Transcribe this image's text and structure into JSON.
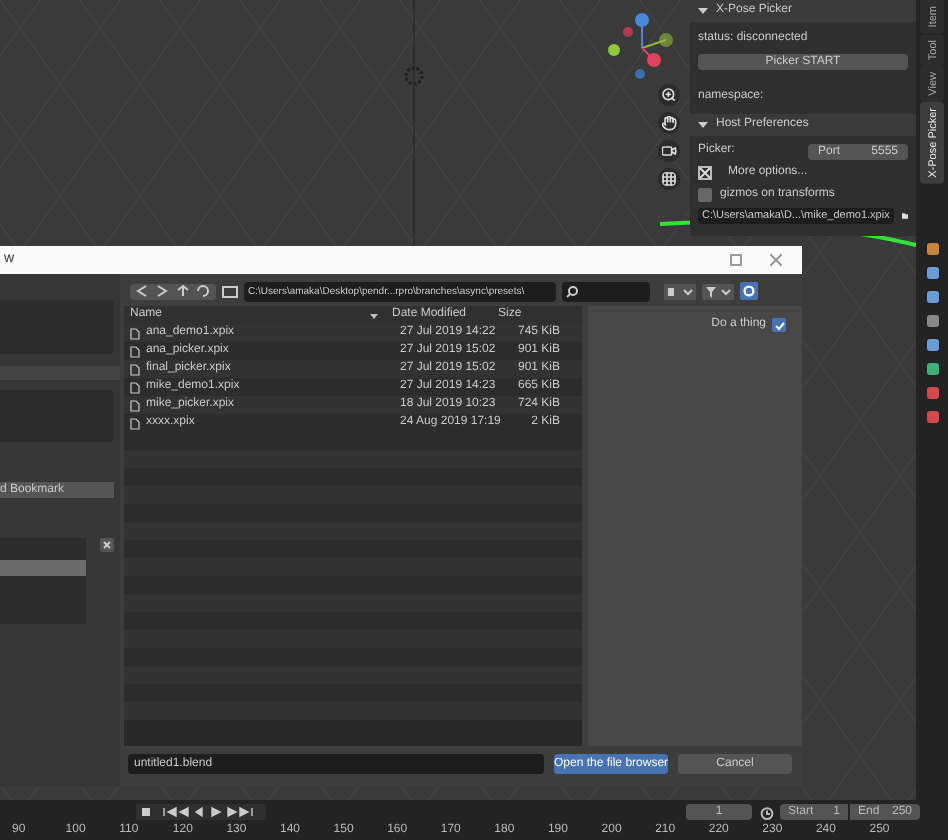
{
  "sidebar": {
    "sections": [
      {
        "title": "X-Pose Picker",
        "expanded": true
      },
      {
        "title": "Host Preferences",
        "expanded": true
      }
    ],
    "status": "status: disconnected",
    "start_button": "Picker START",
    "namespace_label": "namespace:",
    "picker_label": "Picker:",
    "port_label": "Port",
    "port_value": "5555",
    "options": [
      {
        "kind": "toggle",
        "label": "More options...",
        "checked": true
      },
      {
        "kind": "checkbox",
        "label": "gizmos on transforms",
        "checked": false
      }
    ],
    "path_value": "C:\\Users\\amaka\\D...\\mike_demo1.xpix"
  },
  "vertical_tabs": [
    {
      "label": "Item",
      "selected": false
    },
    {
      "label": "Tool",
      "selected": false
    },
    {
      "label": "View",
      "selected": false
    },
    {
      "label": "X-Pose Picker",
      "selected": true
    }
  ],
  "dialog": {
    "title": "w",
    "path": "C:\\Users\\amaka\\Desktop\\pendr...rpro\\branches\\async\\presets\\",
    "bookmark_button": "d Bookmark",
    "columns": [
      "Name",
      "Date Modified",
      "Size"
    ],
    "files": [
      {
        "name": "ana_demo1.xpix",
        "date": "27 Jul 2019 14:22",
        "size": "745 KiB"
      },
      {
        "name": "ana_picker.xpix",
        "date": "27 Jul 2019 15:02",
        "size": "901 KiB"
      },
      {
        "name": "final_picker.xpix",
        "date": "27 Jul 2019 15:02",
        "size": "901 KiB"
      },
      {
        "name": "mike_demo1.xpix",
        "date": "27 Jul 2019 14:23",
        "size": "665 KiB"
      },
      {
        "name": "mike_picker.xpix",
        "date": "18 Jul 2019 10:23",
        "size": "724 KiB"
      },
      {
        "name": "xxxx.xpix",
        "date": "24 Aug 2019 17:19",
        "size": "2 KiB"
      }
    ],
    "option": {
      "label": "Do a thing",
      "checked": true
    },
    "filename": "untitled1.blend",
    "buttons": [
      {
        "label": "Open the file browser",
        "kind": "primary"
      },
      {
        "label": "Cancel",
        "kind": "secondary"
      }
    ]
  },
  "timeline": {
    "frame": "1",
    "start_label": "Start",
    "start": "1",
    "end_label": "End",
    "end": "250",
    "ticks": [
      "90",
      "100",
      "110",
      "120",
      "130",
      "140",
      "150",
      "160",
      "170",
      "180",
      "190",
      "200",
      "210",
      "220",
      "230",
      "240",
      "250"
    ]
  }
}
